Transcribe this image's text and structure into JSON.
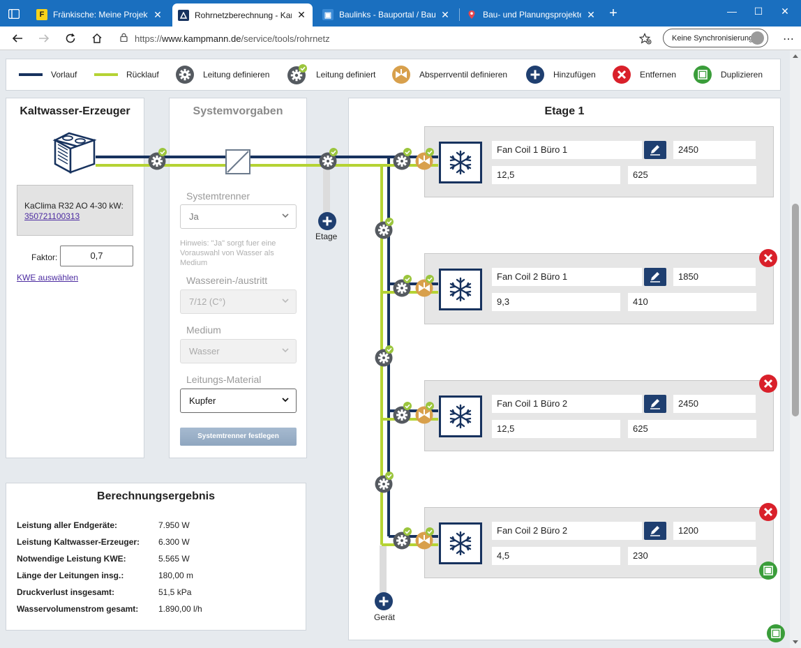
{
  "browser": {
    "tabs": [
      {
        "label": "Fränkische: Meine Projekte"
      },
      {
        "label": "Rohrnetzberechnung - Kampmann"
      },
      {
        "label": "Baulinks - Bauportal / Baumagazin"
      },
      {
        "label": "Bau- und Planungsprojekte auf Baulinks"
      }
    ],
    "url_prefix": "https://",
    "url_host": "www.kampmann.de",
    "url_path": "/service/tools/rohrnetz",
    "sync_label": "Keine Synchronisierung"
  },
  "legend": {
    "vorlauf": "Vorlauf",
    "ruecklauf": "Rücklauf",
    "leitung_definieren": "Leitung definieren",
    "leitung_definiert": "Leitung definiert",
    "absperrventil": "Absperrventil definieren",
    "hinzufuegen": "Hinzufügen",
    "entfernen": "Entfernen",
    "duplizieren": "Duplizieren"
  },
  "colors": {
    "vorlauf": "#17325e",
    "ruecklauf": "#b5d334",
    "gear": "#555a60",
    "check": "#9bc53d",
    "valve": "#d8a04c",
    "add": "#1f3f70",
    "remove": "#d9202a",
    "duplicate": "#3a9d3a"
  },
  "kwe": {
    "title": "Kaltwasser-Erzeuger",
    "device_name": "KaClima R32 AO 4-30 kW:",
    "device_number": "350721100313",
    "faktor_label": "Faktor:",
    "faktor_value": "0,7",
    "select_link": "KWE auswählen"
  },
  "systemvorgaben": {
    "title": "Systemvorgaben",
    "systemtrenner_label": "Systemtrenner",
    "systemtrenner_value": "Ja",
    "hint": "Hinweis: \"Ja\" sorgt fuer eine Vorauswahl von Wasser als Medium",
    "wasser_label": "Wasserein-/austritt",
    "wasser_value": "7/12 (C°)",
    "medium_label": "Medium",
    "medium_value": "Wasser",
    "material_label": "Leitungs-Material",
    "material_value": "Kupfer",
    "button": "Systemtrenner festlegen"
  },
  "ergebnis": {
    "title": "Berechnungsergebnis",
    "rows": [
      {
        "label": "Leistung aller Endgeräte:",
        "value": "7.950 W"
      },
      {
        "label": "Leistung Kaltwasser-Erzeuger:",
        "value": "6.300 W"
      },
      {
        "label": "Notwendige Leistung KWE:",
        "value": "5.565 W"
      },
      {
        "label": "Länge der Leitungen insg.:",
        "value": "180,00 m"
      },
      {
        "label": "Druckverlust insgesamt:",
        "value": "51,5 kPa"
      },
      {
        "label": "Wasservolumenstrom gesamt:",
        "value": "1.890,00 l/h"
      }
    ]
  },
  "etage": {
    "title": "Etage 1",
    "add_etage_label": "Etage",
    "add_geraet_label": "Gerät",
    "devices": [
      {
        "name": "Fan Coil 1 Büro 1",
        "value1": "2450",
        "value2": "12,5",
        "value3": "625"
      },
      {
        "name": "Fan Coil 2 Büro 1",
        "value1": "1850",
        "value2": "9,3",
        "value3": "410"
      },
      {
        "name": "Fan Coil 1 Büro 2",
        "value1": "2450",
        "value2": "12,5",
        "value3": "625"
      },
      {
        "name": "Fan Coil 2 Büro 2",
        "value1": "1200",
        "value2": "4,5",
        "value3": "230"
      }
    ]
  }
}
